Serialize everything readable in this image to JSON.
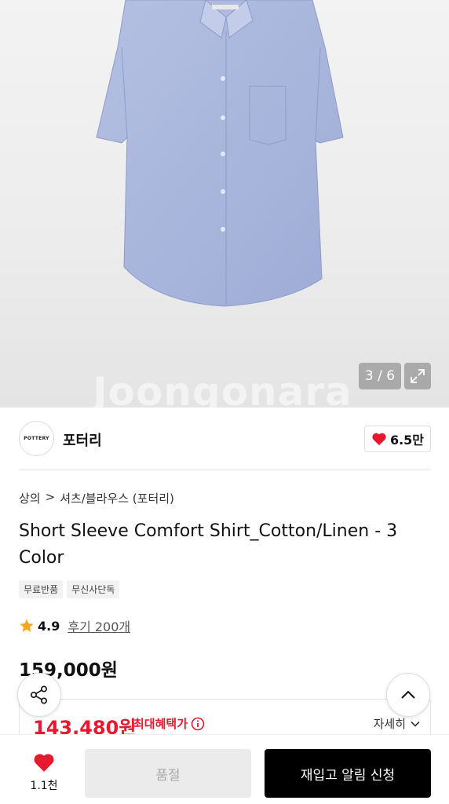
{
  "gallery": {
    "counter": "3 / 6",
    "watermark": "Joongonara"
  },
  "brand": {
    "logo_text": "POTTERY",
    "name": "포터리",
    "likes": "6.5만"
  },
  "breadcrumb": {
    "category": "상의",
    "separator": ">",
    "subcategory": "셔츠/블라우스 (포터리)"
  },
  "product": {
    "title": "Short Sleeve Comfort Shirt_Cotton/Linen - 3 Color",
    "tags": [
      "무료반품",
      "무신사단독"
    ],
    "rating": "4.9",
    "reviews": "후기 200개",
    "price": "159,000원"
  },
  "benefit": {
    "sale_price": "143,480원",
    "label": "최대혜택가",
    "detail": "자세히"
  },
  "bottom_bar": {
    "wish_count": "1.1천",
    "soldout_label": "품절",
    "restock_label": "재입고 알림 신청"
  },
  "colors": {
    "accent_red": "#e8182e",
    "shirt_blue": "#a9b6dc",
    "primary_button": "#000000"
  },
  "icons": [
    "expand-icon",
    "heart-icon",
    "chevron-right-icon",
    "star-icon",
    "info-icon",
    "chevron-down-icon",
    "share-icon",
    "chevron-up-icon"
  ]
}
